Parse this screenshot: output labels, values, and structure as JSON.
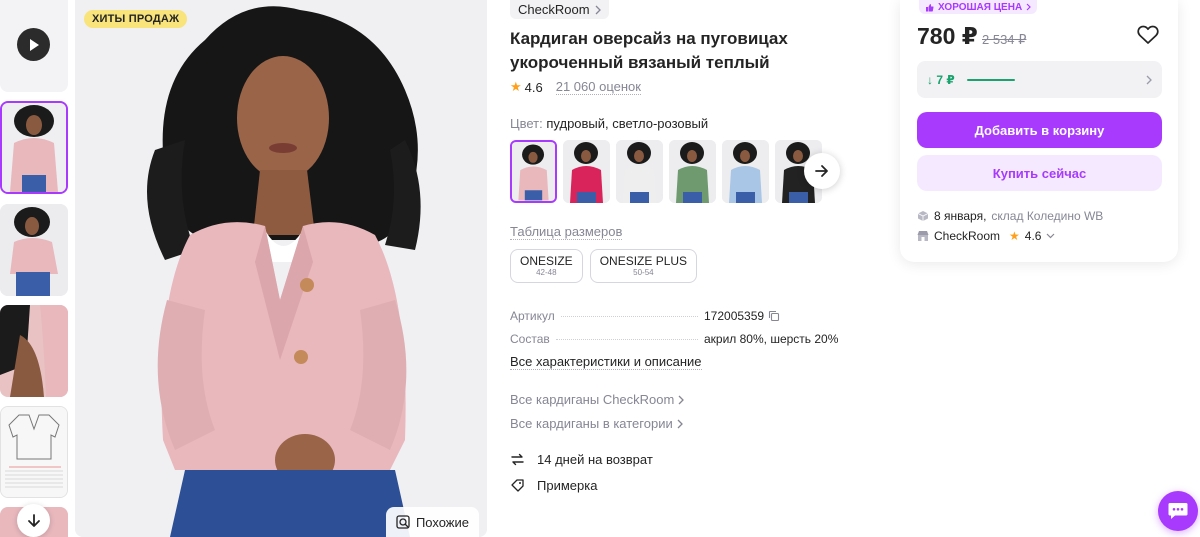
{
  "gallery": {
    "badge": "ХИТЫ ПРОДАЖ",
    "similar_label": "Похожие"
  },
  "product": {
    "brand": "CheckRoom",
    "title_line1": "Кардиган оверсайз на пуговицах",
    "title_line2": "укороченный вязаный теплый",
    "rating": "4.6",
    "reviews": "21 060 оценок",
    "color_label": "Цвет:",
    "color_value": "пудровый, светло-розовый",
    "swatch_colors": [
      "#e8b8bd",
      "#d8245a",
      "#eeeeee",
      "#6f9a70",
      "#a9c6e6",
      "#222222"
    ],
    "size_table_link": "Таблица размеров",
    "sizes": [
      {
        "name": "ONESIZE",
        "range": "42-48"
      },
      {
        "name": "ONESIZE PLUS",
        "range": "50-54"
      }
    ],
    "specs": [
      {
        "key": "Артикул",
        "value": "172005359"
      },
      {
        "key": "Состав",
        "value": "акрил 80%, шерсть 20%"
      }
    ],
    "all_chars_link": "Все характеристики и описание",
    "links": [
      "Все кардиганы CheckRoom",
      "Все кардиганы в категории"
    ],
    "features": [
      "14 дней на возврат",
      "Примерка"
    ]
  },
  "buy": {
    "good_price_badge": "ХОРОШАЯ ЦЕНА",
    "price": "780 ₽",
    "old_price": "2 534 ₽",
    "bonus": "7 ₽",
    "add_to_cart": "Добавить в корзину",
    "buy_now": "Купить сейчас",
    "delivery_date": "8 января,",
    "warehouse": "склад Коледино WB",
    "seller": "CheckRoom",
    "seller_rating": "4.6"
  },
  "colors": {
    "accent": "#a73afd",
    "accent_light": "#f5e9ff",
    "badge_yellow": "#f8e47a",
    "bonus_green": "#1aa36f",
    "star": "#ff9f1a"
  }
}
